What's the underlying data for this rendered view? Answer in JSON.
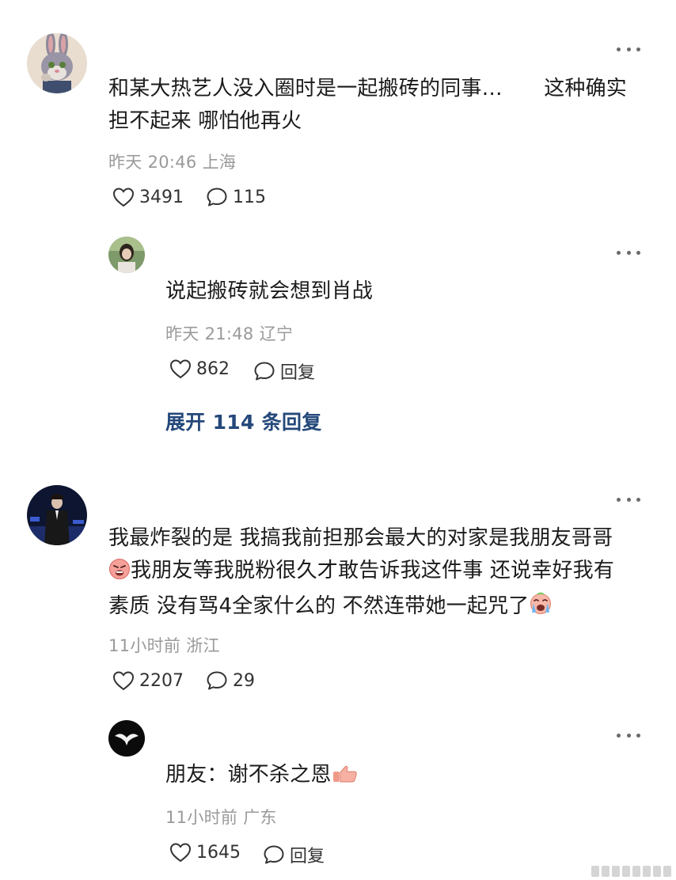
{
  "comments": [
    {
      "text": "和某大热艺人没入圈时是一起搬砖的同事…　　这种确实担不起来 哪怕他再火",
      "time": "昨天 20:46",
      "location": "上海",
      "likes": "3491",
      "replies": "115",
      "reply": {
        "text": "说起搬砖就会想到肖战",
        "time": "昨天 21:48",
        "location": "辽宁",
        "likes": "862",
        "reply_label": "回复"
      },
      "expand_label": "展开 114 条回复"
    },
    {
      "text_part1": "我最炸裂的是 我搞我前担那会最大的对家是我朋友哥哥",
      "text_part2": "我朋友等我脱粉很久才敢告诉我这件事 还说幸好我有素质 没有骂4全家什么的 不然连带她一起咒了",
      "emoji1": "angry-face-emoji",
      "emoji2": "crying-face-emoji",
      "time": "11小时前",
      "location": "浙江",
      "likes": "2207",
      "replies": "29",
      "reply": {
        "text": "朋友：谢不杀之恩",
        "emoji": "thumbs-up-emoji",
        "time": "11小时前",
        "location": "广东",
        "likes": "1645",
        "reply_label": "回复"
      }
    }
  ]
}
